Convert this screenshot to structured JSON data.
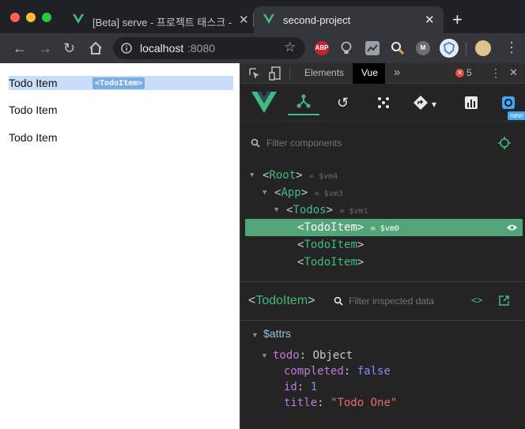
{
  "browser": {
    "tabs": [
      {
        "title": "[Beta] serve - 프로젝트 태스크 - Vue",
        "active": false
      },
      {
        "title": "second-project",
        "active": true
      }
    ],
    "url": {
      "host": "localhost",
      "port": ":8080"
    }
  },
  "extensions": [
    "ABP",
    "bulb",
    "chart",
    "magnifier",
    "M",
    "shield",
    "avatar"
  ],
  "page": {
    "items": [
      "Todo Item",
      "Todo Item",
      "Todo Item"
    ],
    "highlight_tag": "<TodoItem>"
  },
  "devtools": {
    "tabs": {
      "elements": "Elements",
      "vue": "Vue"
    },
    "error_count": "5",
    "vue_toolbar": {
      "new_badge": "new"
    },
    "filter_placeholder": "Filter components",
    "tree": [
      {
        "tag": "Root",
        "vm": "$vm4",
        "depth": 0,
        "expanded": true,
        "selected": false
      },
      {
        "tag": "App",
        "vm": "$vm3",
        "depth": 1,
        "expanded": true,
        "selected": false
      },
      {
        "tag": "Todos",
        "vm": "$vm1",
        "depth": 2,
        "expanded": true,
        "selected": false
      },
      {
        "tag": "TodoItem",
        "vm": "$vm0",
        "depth": 3,
        "expanded": false,
        "selected": true
      },
      {
        "tag": "TodoItem",
        "vm": "",
        "depth": 3,
        "expanded": false,
        "selected": false
      },
      {
        "tag": "TodoItem",
        "vm": "",
        "depth": 3,
        "expanded": false,
        "selected": false
      }
    ],
    "inspector": {
      "component": "TodoItem",
      "filter_placeholder": "Filter inspected data",
      "section": "$attrs",
      "object_key": "todo",
      "object_type": "Object",
      "fields": [
        {
          "key": "completed",
          "value": "false",
          "kind": "bool"
        },
        {
          "key": "id",
          "value": "1",
          "kind": "num"
        },
        {
          "key": "title",
          "value": "\"Todo One\"",
          "kind": "str"
        }
      ]
    }
  },
  "colors": {
    "vue_green": "#42b983",
    "selected_row": "#53a479",
    "devtools_bg": "#242424"
  }
}
